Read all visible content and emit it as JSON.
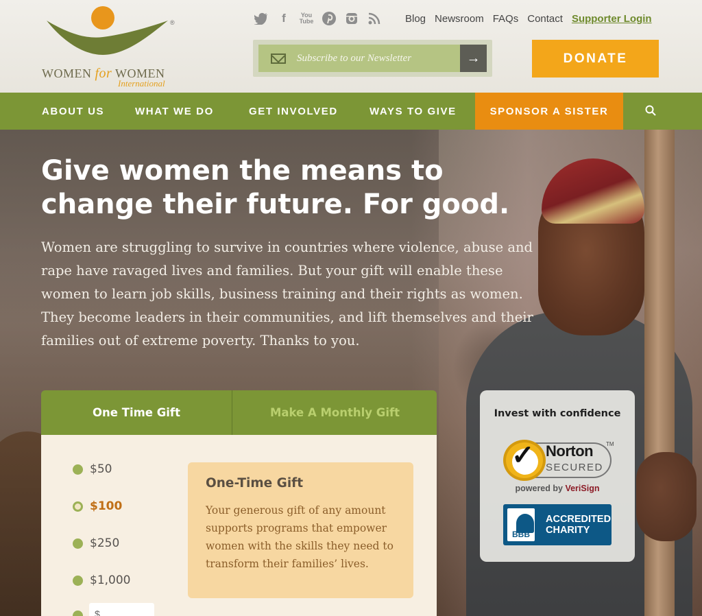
{
  "header": {
    "logo": {
      "brand_word_1": "WOMEN",
      "brand_word_for": "for",
      "brand_word_2": "WOMEN",
      "brand_sub": "International",
      "reg_mark": "®"
    },
    "social_icons": [
      "twitter-icon",
      "facebook-icon",
      "youtube-icon",
      "pinterest-icon",
      "instagram-icon",
      "rss-icon"
    ],
    "social_glyphs": {
      "facebook": "f",
      "youtube_top": "You",
      "youtube_bottom": "Tube"
    },
    "top_links": [
      "Blog",
      "Newsroom",
      "FAQs",
      "Contact"
    ],
    "supporter_login": "Supporter Login",
    "newsletter": {
      "placeholder": "Subscribe to our Newsletter",
      "submit_glyph": "→"
    },
    "donate_label": "DONATE"
  },
  "nav": {
    "items": [
      "ABOUT US",
      "WHAT WE DO",
      "GET INVOLVED",
      "WAYS TO GIVE"
    ],
    "sponsor": "SPONSOR A SISTER"
  },
  "hero": {
    "headline": "Give women the means to change their future. For good.",
    "lede": "Women are struggling to survive in countries where violence, abuse and rape have ravaged lives and families. But your gift will enable these women to learn job skills, business training and their rights as women. They become leaders in their communities, and lift themselves and their families out of extreme poverty. Thanks to you."
  },
  "donation": {
    "tabs": [
      "One Time Gift",
      "Make A Monthly Gift"
    ],
    "active_tab": 0,
    "amounts": [
      "$50",
      "$100",
      "$250",
      "$1,000"
    ],
    "selected_amount": "$100",
    "custom_prefix": "$",
    "info_title": "One-Time Gift",
    "info_body": "Your generous gift of any amount supports programs that empower women with the skills they need to transform their families’ lives."
  },
  "trust": {
    "title": "Invest with confidence",
    "norton": {
      "line1": "Norton",
      "line2": "SECURED",
      "tm": "TM"
    },
    "powered_by": "powered by",
    "verisign": "VeriSign",
    "bbb": {
      "mark": "BBB",
      "line1": "ACCREDITED",
      "line2": "CHARITY"
    }
  },
  "colors": {
    "nav_green": "#7c9636",
    "donate_orange": "#f3a61a",
    "sponsor_orange": "#e98d11",
    "login_green": "#6e8a2c"
  }
}
